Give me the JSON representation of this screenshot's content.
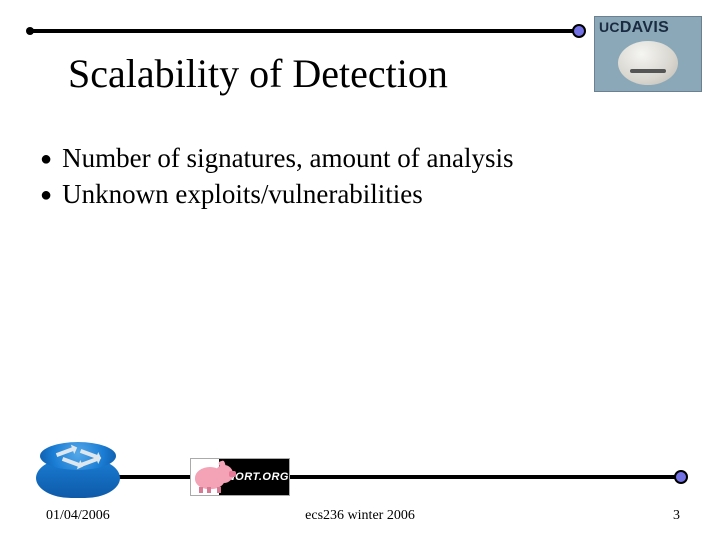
{
  "header": {
    "logo_text_uc": "UC",
    "logo_text_davis": "DAVIS"
  },
  "title": "Scalability of Detection",
  "bullets": [
    "Number of signatures, amount of analysis",
    "Unknown exploits/vulnerabilities"
  ],
  "logos": {
    "snort_label": "SNORT.ORG"
  },
  "footer": {
    "date": "01/04/2006",
    "course": "ecs236 winter 2006",
    "page": "3"
  }
}
